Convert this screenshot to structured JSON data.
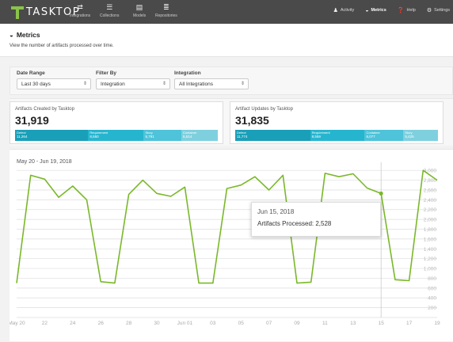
{
  "nav": {
    "logo": "TASKTOP",
    "items": [
      {
        "label": "Integrations",
        "icon": "arrows-icon"
      },
      {
        "label": "Collections",
        "icon": "stack-icon"
      },
      {
        "label": "Models",
        "icon": "document-icon"
      },
      {
        "label": "Repositories",
        "icon": "database-icon"
      }
    ],
    "right": [
      {
        "label": "Activity",
        "icon": "person-icon"
      },
      {
        "label": "Metrics",
        "icon": "gauge-icon"
      },
      {
        "label": "Help",
        "icon": "help-icon"
      },
      {
        "label": "Settings",
        "icon": "gear-icon"
      }
    ]
  },
  "page": {
    "title": "Metrics",
    "subtitle": "View the number of artifacts processed over time."
  },
  "filters": {
    "date_range_label": "Date Range",
    "date_range_value": "Last 30 days",
    "filter_by_label": "Filter By",
    "filter_by_value": "Integration",
    "integration_label": "Integration",
    "integration_value": "All Integrations"
  },
  "cards": [
    {
      "title": "Artifacts Created by Tasktop",
      "value": "31,919",
      "segments": [
        {
          "label": "Defect",
          "value": "11,264",
          "color": "#1a9fb8",
          "weight": 11264
        },
        {
          "label": "Requirement",
          "value": "8,550",
          "color": "#26b5cf",
          "weight": 8550
        },
        {
          "label": "Story",
          "value": "5,791",
          "color": "#4ec3d9",
          "weight": 5791
        },
        {
          "label": "Container",
          "value": "5,614",
          "color": "#7fd0de",
          "weight": 5614
        }
      ]
    },
    {
      "title": "Artifact Updates by Tasktop",
      "value": "31,835",
      "segments": [
        {
          "label": "Defect",
          "value": "11,774",
          "color": "#1a9fb8",
          "weight": 11774
        },
        {
          "label": "Requirement",
          "value": "8,559",
          "color": "#26b5cf",
          "weight": 8559
        },
        {
          "label": "Container",
          "value": "6,077",
          "color": "#4ec3d9",
          "weight": 6077
        },
        {
          "label": "Story",
          "value": "5,425",
          "color": "#7fd0de",
          "weight": 5425
        }
      ]
    }
  ],
  "chart_data": {
    "type": "line",
    "title": "May 20 - Jun 19, 2018",
    "x_tick_labels": [
      "May 20",
      "22",
      "24",
      "26",
      "28",
      "30",
      "Jun 01",
      "03",
      "05",
      "07",
      "09",
      "11",
      "13",
      "15",
      "17",
      "19"
    ],
    "y_tick_labels": [
      "200",
      "400",
      "600",
      "800",
      "1,000",
      "1,200",
      "1,400",
      "1,600",
      "1,800",
      "2,000",
      "2,200",
      "2,400",
      "2,600",
      "2,800",
      "3,000"
    ],
    "ylim": [
      0,
      3100
    ],
    "x": [
      0,
      1,
      2,
      3,
      4,
      5,
      6,
      7,
      8,
      9,
      10,
      11,
      12,
      13,
      14,
      15,
      16,
      17,
      18,
      19,
      20,
      21,
      22,
      23,
      24,
      25,
      26,
      27,
      28,
      29,
      30
    ],
    "series": [
      {
        "values": [
          700,
          2900,
          2820,
          2450,
          2680,
          2400,
          730,
          700,
          2510,
          2800,
          2530,
          2470,
          2660,
          700,
          700,
          2630,
          2700,
          2870,
          2600,
          2900,
          700,
          720,
          2940,
          2870,
          2930,
          2640,
          2528,
          770,
          750,
          3000,
          2800
        ],
        "color": "#7ab829"
      }
    ],
    "highlight_index": 26,
    "tooltip": {
      "date": "Jun 15, 2018",
      "text": "Artifacts Processed: 2,528"
    },
    "grid": true
  }
}
